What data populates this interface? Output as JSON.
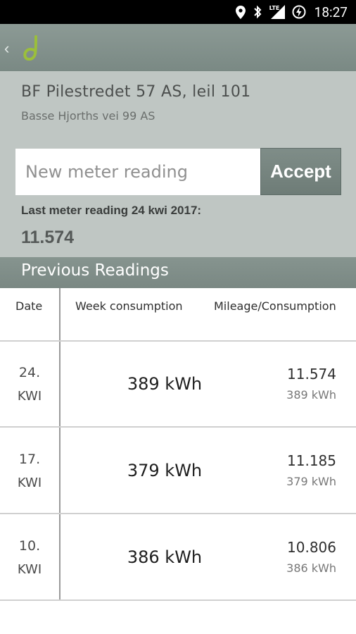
{
  "status_bar": {
    "time": "18:27",
    "network": "LTE",
    "icons": [
      "location-icon",
      "bluetooth-icon",
      "signal-icon",
      "battery-charging-icon"
    ]
  },
  "app_bar": {
    "back_label": "‹",
    "logo_letter": "d",
    "accent_color": "#9bbf3b"
  },
  "header": {
    "title": "BF Pilestredet 57 AS, leil 101",
    "subtitle": "Basse Hjorths vei 99 AS"
  },
  "reading_form": {
    "placeholder": "New meter reading",
    "value": "",
    "accept_label": "Accept"
  },
  "last_reading": {
    "label": "Last meter reading 24 kwi 2017:",
    "value": "11.574"
  },
  "previous": {
    "title": "Previous Readings",
    "columns": [
      "Date",
      "Week consumption",
      "Mileage/Consumption"
    ],
    "rows": [
      {
        "week_num": "24.",
        "week_label": "KWI",
        "consumption": "389 kWh",
        "mileage": "11.574",
        "sub_consumption": "389 kWh"
      },
      {
        "week_num": "17.",
        "week_label": "KWI",
        "consumption": "379 kWh",
        "mileage": "11.185",
        "sub_consumption": "379 kWh"
      },
      {
        "week_num": "10.",
        "week_label": "KWI",
        "consumption": "386 kWh",
        "mileage": "10.806",
        "sub_consumption": "386 kWh"
      }
    ]
  }
}
